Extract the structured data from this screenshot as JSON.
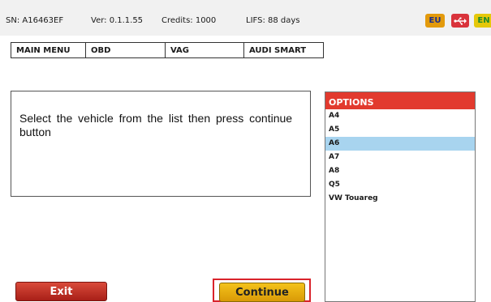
{
  "status": {
    "serial": "SN: A16463EF",
    "version": "Ver: 0.1.1.55",
    "credits": "Credits: 1000",
    "lifs": "LIFS: 88 days",
    "badges": {
      "eu": "EU",
      "usb_icon": "usb-icon",
      "en": "EN"
    }
  },
  "breadcrumb": [
    "MAIN MENU",
    "OBD",
    "VAG",
    "AUDI SMART"
  ],
  "message": "Select the vehicle from the list then press continue button",
  "options": {
    "header": "OPTIONS",
    "items": [
      "A4",
      "A5",
      "A6",
      "A7",
      "A8",
      "Q5",
      "VW Touareg"
    ],
    "selected": "A6"
  },
  "buttons": {
    "exit": "Exit",
    "continue": "Continue"
  },
  "colors": {
    "options_header": "#e23a2e",
    "selected_row": "#a8d4ef",
    "exit_button": "#c0342a",
    "continue_button": "#f0b618",
    "continue_highlight": "#d9232b"
  }
}
